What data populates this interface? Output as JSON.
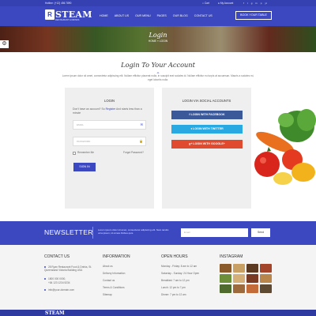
{
  "topbar": {
    "phone": "Hotline: (+12) 456 7890",
    "cart": "Cart",
    "account": "My Account",
    "social": [
      "f",
      "t",
      "g",
      "in",
      "p",
      "yt"
    ]
  },
  "header": {
    "logo_letter": "R",
    "logo_text": "STEAM",
    "logo_sub": "RESTAURANT & DRINKS",
    "nav": [
      "HOME",
      "ABOUT US",
      "OUR MENU",
      "PAGES",
      "OUR BLOG",
      "CONTACT US"
    ],
    "book_label": "BOOK YOUR TABLE"
  },
  "banner": {
    "title": "Login",
    "crumb": "HOME » LOGIN"
  },
  "main": {
    "heading": "Login To Your Account",
    "intro": "Lorem ipsum dolor sit amet, consectetur adipiscing elit. Nullam efficitur placerat nulla, in suscipit erat sodales id. Nullam efficitur eu turpis at accumsan. Mauris a sodales mi, eget lobortis nulla."
  },
  "login": {
    "title": "LOGIN",
    "text_pre": "Don't have an account? So",
    "register_link": "Register",
    "text_post": "And starts less than a minute",
    "email_placeholder": "EMAIL",
    "password_placeholder": "PASSWORD",
    "remember": "Remember Me",
    "forgot": "Forgot Password?",
    "signin": "SIGN IN"
  },
  "social_login": {
    "title": "LOGIN VIA SOCIAL ACCOUNTS",
    "facebook": "LOGIN WITH FACEBOOK",
    "twitter": "LOGIN WITH TWITTER",
    "google": "LOGIN WITH GOOGLE+",
    "colors": {
      "facebook": "#3b5998",
      "twitter": "#29a9e1",
      "google": "#e04a2f"
    }
  },
  "newsletter": {
    "title": "NEWSLETTER",
    "text": "Lorem ipsum dolor sit amet, consectetur adipiscing elit. Nam iaculis urna ipsum, id ornare finibus quis.",
    "email_placeholder": "Email",
    "send": "Send"
  },
  "footer": {
    "contact": {
      "title": "CONTACT US",
      "address": "28 Ryan Restaurant Food & Drinks, St. Queensland Victoria Building USA",
      "phone1": "1800 000 0000,",
      "phone2": "+84 123 1234 5234",
      "email": "info@your-domain.com"
    },
    "info": {
      "title": "INFORMATION",
      "items": [
        "About us",
        "Delivery Information",
        "Contact us",
        "Terms & Conditions",
        "Sitemap"
      ]
    },
    "hours": {
      "title": "OPEN HOURS",
      "items": [
        "Monday - Friday: 8 am to 12 am",
        "Saturday - Sunday: 24 Hour Open",
        "Breakfast: 7 am to 12 pm",
        "Lunch: 12 pm to 7 pm",
        "Dinner: 7 pm to 12 am"
      ]
    },
    "instagram": {
      "title": "INSTAGRAM"
    }
  },
  "bottom": {
    "logo_text": "STEAM"
  },
  "colors": {
    "primary": "#3b48c0",
    "dark": "#3541b0"
  }
}
